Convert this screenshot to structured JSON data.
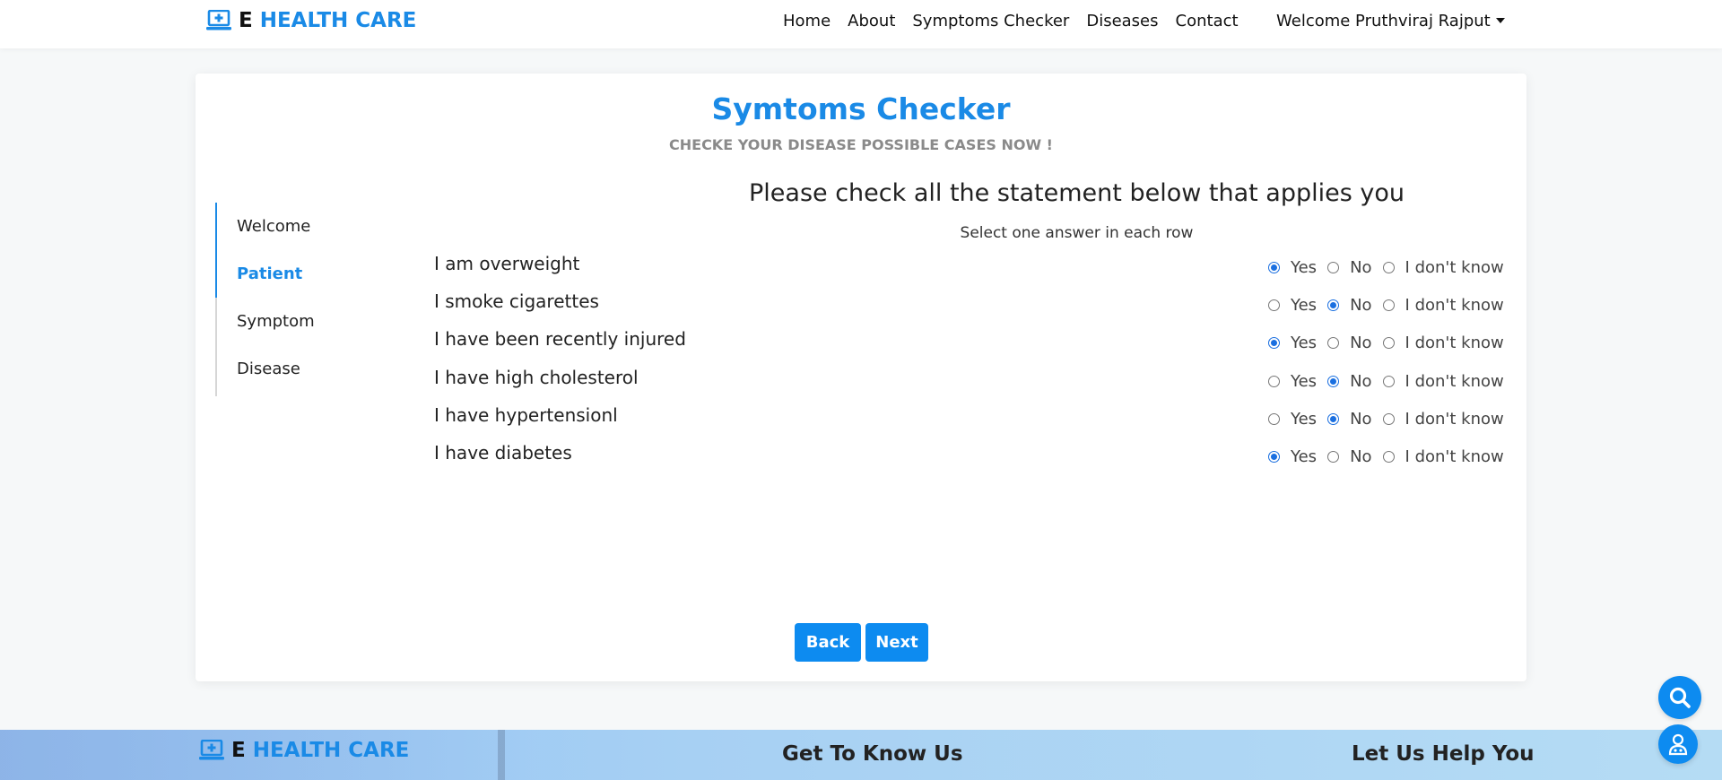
{
  "header": {
    "brand_e": "E",
    "brand_rest": "HEALTH CARE",
    "logo_icon": "monitor-medical-icon",
    "nav": [
      "Home",
      "About",
      "Symptoms Checker",
      "Diseases",
      "Contact"
    ],
    "user_menu": "Welcome Pruthviraj Rajput"
  },
  "page": {
    "title": "Symtoms Checker",
    "subtitle": "CHECKE YOUR DISEASE POSSIBLE CASES NOW !"
  },
  "steps": [
    {
      "label": "Welcome",
      "active": false
    },
    {
      "label": "Patient",
      "active": true
    },
    {
      "label": "Symptom",
      "active": false
    },
    {
      "label": "Disease",
      "active": false
    }
  ],
  "questions": {
    "heading": "Please check all the statement below that applies you",
    "instruction": "Select one answer in each row",
    "options": [
      "Yes",
      "No",
      "I don't know"
    ],
    "rows": [
      {
        "statement": "I am overweight",
        "selected": "Yes"
      },
      {
        "statement": "I smoke cigarettes",
        "selected": "No"
      },
      {
        "statement": "I have been recently injured",
        "selected": "Yes"
      },
      {
        "statement": "I have high cholesterol",
        "selected": "No"
      },
      {
        "statement": "I have hypertensionl",
        "selected": "No"
      },
      {
        "statement": "I have diabetes",
        "selected": "Yes"
      }
    ]
  },
  "buttons": {
    "back": "Back",
    "next": "Next"
  },
  "footer": {
    "brand_e": "E",
    "brand_rest": "HEALTH CARE",
    "col1": "Get To Know Us",
    "col2": "Let Us Help You"
  },
  "floating": {
    "search_icon": "search-icon",
    "doctor_icon": "doctor-icon"
  },
  "colors": {
    "accent": "#1a8ae6",
    "button": "#0d8bf0",
    "radio": "#1a6fe0"
  }
}
